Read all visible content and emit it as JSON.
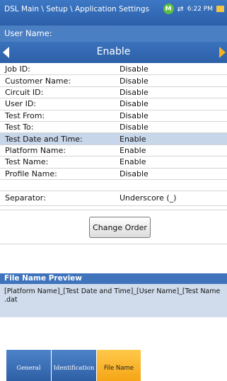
{
  "header": {
    "breadcrumb": "DSL Main \\ Setup \\ Application Settings",
    "status_badge": "M",
    "usb_icon": "⇄",
    "time": "6:22 PM",
    "battery_icon": "battery-icon"
  },
  "user_name": {
    "label": "User Name:",
    "value": "Enable"
  },
  "fields": [
    {
      "label": "Job ID:",
      "value": "Disable"
    },
    {
      "label": "Customer Name:",
      "value": "Disable"
    },
    {
      "label": "Circuit ID:",
      "value": "Disable"
    },
    {
      "label": "User ID:",
      "value": "Disable"
    },
    {
      "label": "Test From:",
      "value": "Disable"
    },
    {
      "label": "Test To:",
      "value": "Disable"
    },
    {
      "label": "Test Date and Time:",
      "value": "Enable"
    },
    {
      "label": "Platform Name:",
      "value": "Enable"
    },
    {
      "label": "Test Name:",
      "value": "Enable"
    },
    {
      "label": "Profile Name:",
      "value": "Disable"
    }
  ],
  "separator": {
    "label": "Separator:",
    "value": "Underscore (_)"
  },
  "change_order_label": "Change Order",
  "preview": {
    "title": "File Name Preview",
    "line1": "[Platform Name]_[Test Date and Time]_[User Name]_[Test Name",
    "line2": ".dat"
  },
  "tabs": [
    "General",
    "Identification",
    "File Name"
  ],
  "colors": {
    "accent": "#f5a515",
    "header_blue": "#2c5fa8",
    "selected_row": "#c8d6ea"
  }
}
